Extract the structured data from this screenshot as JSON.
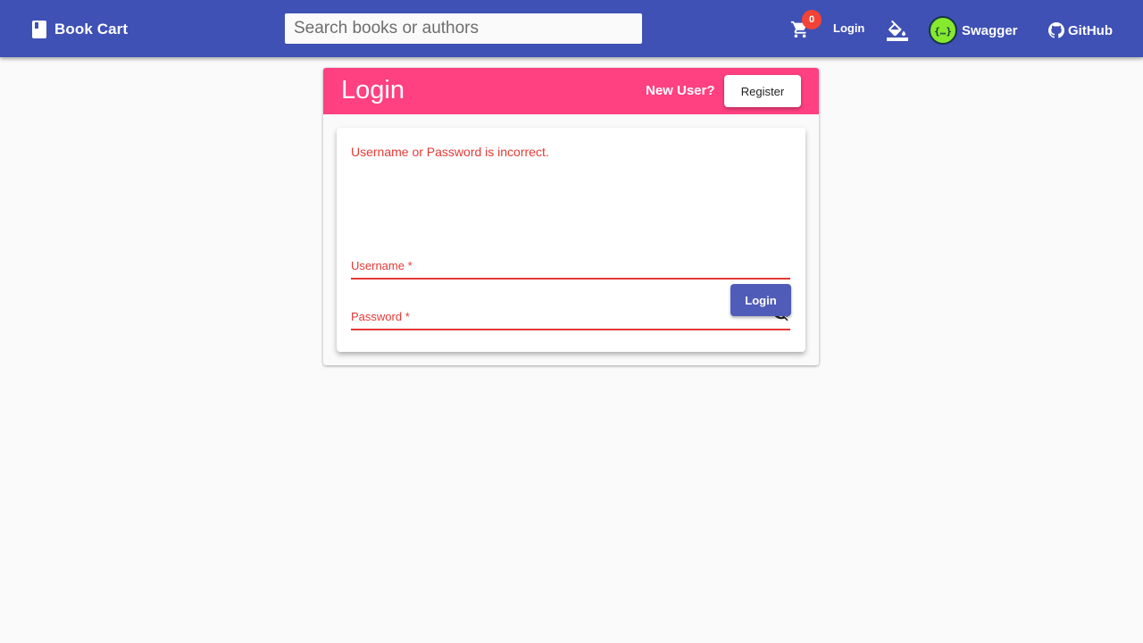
{
  "toolbar": {
    "brand_label": "Book Cart",
    "brand_icon": "book-icon",
    "search_placeholder": "Search books or authors",
    "cart_icon": "shopping-cart-icon",
    "cart_count": "0",
    "login_label": "Login",
    "theme_icon": "format-color-fill-icon",
    "swagger_label": "Swagger",
    "github_label": "GitHub",
    "colors": {
      "primary": "#3f51b5",
      "badge": "#f44336"
    }
  },
  "login_card": {
    "title": "Login",
    "new_user_text": "New User?",
    "register_label": "Register",
    "error_message": "Username or Password is incorrect.",
    "username_label": "Username *",
    "password_label": "Password *",
    "password_toggle_icon": "visibility-off-icon",
    "submit_label": "Login",
    "colors": {
      "header": "#ff4081",
      "error": "#e53935",
      "submit": "#4f5cb8"
    }
  }
}
